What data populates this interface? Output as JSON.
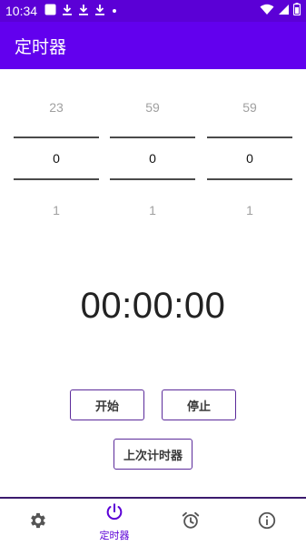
{
  "status_bar": {
    "time": "10:34",
    "left_icons": [
      "notification-square-icon",
      "download-icon",
      "download-icon",
      "download-icon",
      "dot-icon"
    ],
    "right_icons": [
      "wifi-icon",
      "signal-icon",
      "battery-icon"
    ],
    "color": "#5b00d6"
  },
  "app_bar": {
    "title": "定时器",
    "color": "#6200ee"
  },
  "pickers": [
    {
      "prev": "23",
      "current": "0",
      "next": "1"
    },
    {
      "prev": "59",
      "current": "0",
      "next": "1"
    },
    {
      "prev": "59",
      "current": "0",
      "next": "1"
    }
  ],
  "timer": {
    "display": "00:00:00"
  },
  "buttons": {
    "start": "开始",
    "stop": "停止",
    "last_timer": "上次计时器"
  },
  "bottom_nav": {
    "items": [
      {
        "icon": "gear-icon",
        "label": ""
      },
      {
        "icon": "power-icon",
        "label": "定时器",
        "selected": true
      },
      {
        "icon": "alarm-clock-icon",
        "label": ""
      },
      {
        "icon": "info-icon",
        "label": ""
      }
    ],
    "accent": "#5b00d6"
  }
}
